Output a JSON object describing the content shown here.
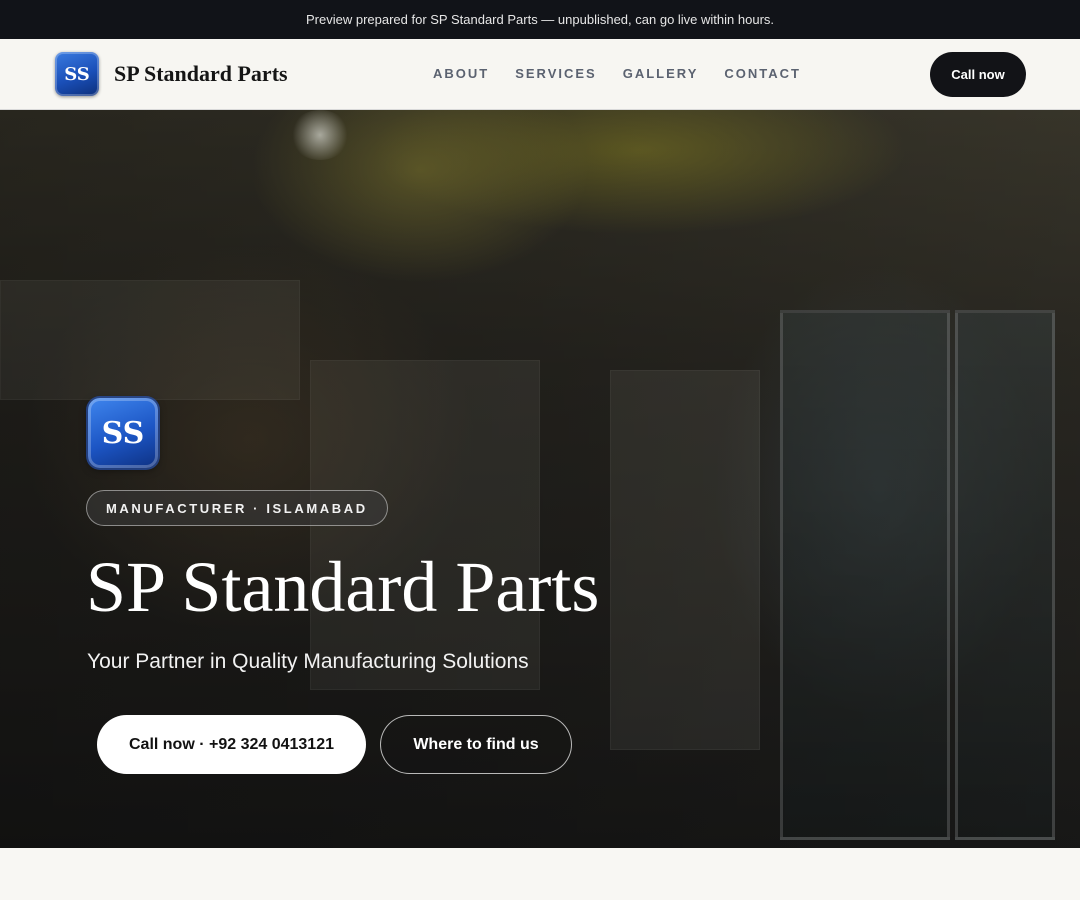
{
  "announcement": "Preview prepared for SP Standard Parts — unpublished, can go live within hours.",
  "brand": {
    "logo_initials": "SS",
    "name": "SP Standard Parts"
  },
  "nav": {
    "links": [
      "ABOUT",
      "SERVICES",
      "GALLERY",
      "CONTACT"
    ],
    "cta_label": "Call now"
  },
  "hero": {
    "logo_initials": "SS",
    "badge": "MANUFACTURER · ISLAMABAD",
    "title": "SP Standard Parts",
    "subtitle": "Your Partner in Quality Manufacturing Solutions",
    "primary_button": "Call now · +92 324 0413121",
    "secondary_button": "Where to find us",
    "background_image": "shop interior with shelves, records and drinks fridge",
    "overlay_color": "#000000"
  },
  "colors": {
    "topbar_bg": "#111318",
    "nav_bg": "#f7f6f2",
    "cta_bg": "#121317",
    "logo_blue": "#1c55c4"
  }
}
